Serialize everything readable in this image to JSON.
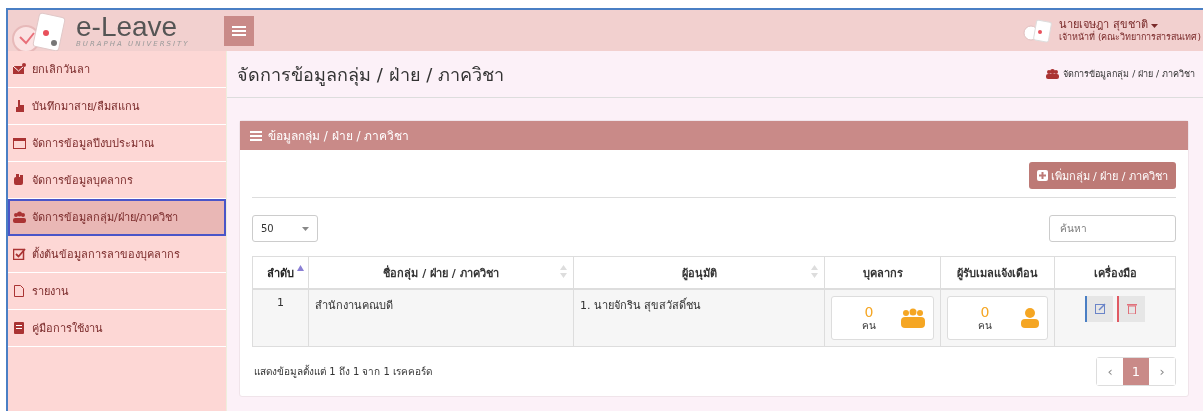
{
  "header": {
    "logo_title": "e-Leave",
    "logo_subtitle": "BURAPHA UNIVERSITY",
    "user_name": "นายเจษฎา สุขชาติ",
    "user_role": "เจ้าหน้าที่ (คณะวิทยาการสารสนเทศ)"
  },
  "sidebar": {
    "items": [
      {
        "label": "ยกเลิกวันลา",
        "selected": false
      },
      {
        "label": "บันทึกมาสาย/ลืมสแกน",
        "selected": false
      },
      {
        "label": "จัดการข้อมูลปีงบประมาณ",
        "selected": false
      },
      {
        "label": "จัดการข้อมูลบุคลากร",
        "selected": false
      },
      {
        "label": "จัดการข้อมูลกลุ่ม/ฝ่าย/ภาควิชา",
        "selected": true
      },
      {
        "label": "ตั้งต้นข้อมูลการลาของบุคลากร",
        "selected": false
      },
      {
        "label": "รายงาน",
        "selected": false
      },
      {
        "label": "คู่มือการใช้งาน",
        "selected": false
      }
    ]
  },
  "page": {
    "title": "จัดการข้อมูลกลุ่ม / ฝ่าย / ภาควิชา",
    "breadcrumb": "จัดการข้อมูลกลุ่ม / ฝ่าย / ภาควิชา"
  },
  "panel": {
    "title": "ข้อมูลกลุ่ม / ฝ่าย / ภาควิชา",
    "add_button": "เพิ่มกลุ่ม / ฝ่าย / ภาควิชา",
    "page_size": "50",
    "search": {
      "placeholder": "ค้นหา"
    }
  },
  "table": {
    "columns": [
      {
        "label": "ลำดับ",
        "sorted": true
      },
      {
        "label": "ชื่อกลุ่ม / ฝ่าย / ภาควิชา",
        "sorted": false
      },
      {
        "label": "ผู้อนุมัติ",
        "sorted": false
      },
      {
        "label": "บุคลากร"
      },
      {
        "label": "ผู้รับเมลแจ้งเดือน"
      },
      {
        "label": "เครื่องมือ"
      }
    ],
    "rows": [
      {
        "index": "1",
        "name": "สำนักงานคณบดี",
        "approver": "1. นายจักริน สุขสวัสดิ์ชน",
        "staff_count": "0",
        "staff_unit": "คน",
        "mail_count": "0",
        "mail_unit": "คน"
      }
    ]
  },
  "footer": {
    "info": "แสดงข้อมูลตั้งแต่ 1 ถึง 1 จาก 1 เรคคอร์ด",
    "pagination": [
      {
        "label": "‹",
        "selected": false
      },
      {
        "label": "1",
        "selected": true
      },
      {
        "label": "›",
        "selected": false
      }
    ]
  }
}
